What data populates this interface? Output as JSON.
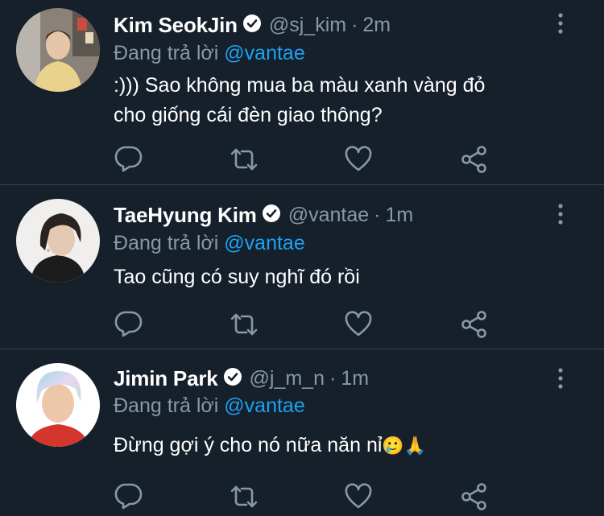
{
  "tweets": [
    {
      "name": "Kim SeokJin",
      "handle": "@sj_kim",
      "separator": "·",
      "time": "2m",
      "reply_prefix": "Đang trả lời",
      "reply_to": "@vantae",
      "text_line1": ":))) Sao không mua ba màu xanh vàng đỏ",
      "text_line2": "cho giống cái đèn giao thông?"
    },
    {
      "name": "TaeHyung Kim",
      "handle": "@vantae",
      "separator": "·",
      "time": "1m",
      "reply_prefix": "Đang trả lời",
      "reply_to": "@vantae",
      "text_line1": "Tao cũng có suy nghĩ đó rồi"
    },
    {
      "name": "Jimin Park",
      "handle": "@j_m_n",
      "separator": "·",
      "time": "1m",
      "reply_prefix": "Đang trả lời",
      "reply_to": "@vantae",
      "text_line1": "Đừng gợi ý cho nó nữa năn nỉ",
      "emoji": "🥲🙏"
    }
  ],
  "icons": {
    "reply": "reply-icon",
    "retweet": "retweet-icon",
    "like": "heart-icon",
    "share": "share-icon",
    "more": "more-vertical-icon",
    "verified": "verified-badge-icon"
  },
  "colors": {
    "background": "#15202b",
    "text": "#ffffff",
    "muted": "#8899a6",
    "link": "#1da1f2",
    "divider": "#38444d"
  }
}
